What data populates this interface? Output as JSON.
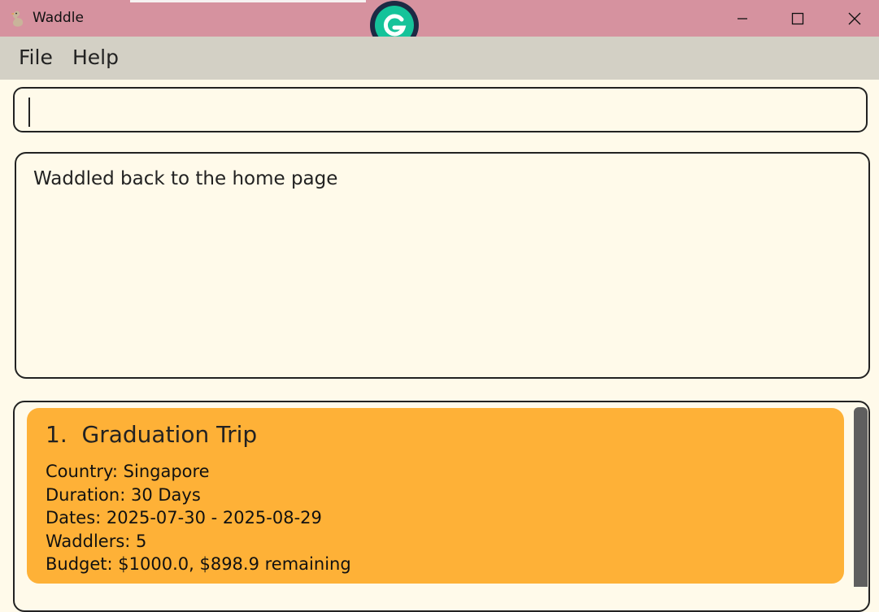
{
  "window": {
    "title": "Waddle",
    "controls": [
      "minimize",
      "maximize",
      "close"
    ]
  },
  "menu": {
    "file_label": "File",
    "help_label": "Help"
  },
  "command_box": {
    "value": ""
  },
  "result": {
    "message": "Waddled back to the home page"
  },
  "trips": [
    {
      "index": "1.",
      "name": "Graduation Trip",
      "country": "Country: Singapore",
      "duration": "Duration: 30 Days",
      "dates": "Dates: 2025-07-30 - 2025-08-29",
      "waddlers": "Waddlers: 5",
      "budget": "Budget: $1000.0, $898.9 remaining"
    }
  ],
  "colors": {
    "titlebar": "#d6929f",
    "menubar": "#d3d0c5",
    "background": "#fffaea",
    "card": "#feb137",
    "scrollbar": "#5f5f5f",
    "grammarly_green": "#15c39a"
  },
  "icons": {
    "app": "duck-icon",
    "overlay": "grammarly-icon"
  }
}
